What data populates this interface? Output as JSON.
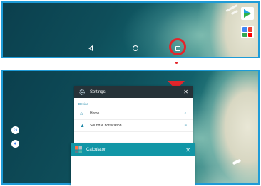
{
  "colors": {
    "highlight": "#e3252b",
    "panel_border": "#1e9bd7",
    "settings_header": "#263238",
    "calculator_header": "#1196a6"
  },
  "top_screen": {
    "nav_bar": {
      "back_icon": "back-triangle-icon",
      "home_icon": "home-circle-icon",
      "recent_apps_icon": "recent-apps-square-icon"
    },
    "highlighted_button": "recent_apps"
  },
  "bottom_screen": {
    "recents": [
      {
        "app": "Settings",
        "close_symbol": "✕",
        "section": "Device",
        "rows": [
          {
            "icon": "home-icon",
            "label": "Home"
          },
          {
            "icon": "bell-icon",
            "label": "Sound & notification"
          }
        ]
      },
      {
        "app": "Calculator",
        "close_symbol": "✕"
      }
    ]
  }
}
